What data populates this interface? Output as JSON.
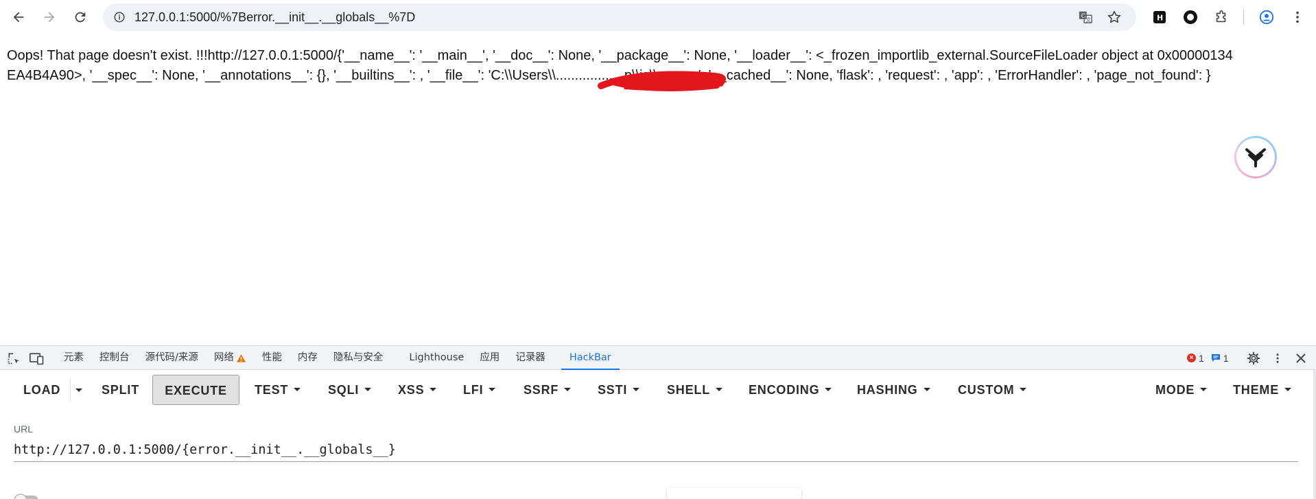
{
  "browser": {
    "address": "127.0.0.1:5000/%7Berror.__init__.__globals__%7D",
    "icons": {
      "back": "arrow-left-icon",
      "forward": "arrow-right-icon",
      "reload": "reload-icon",
      "site_info": "info-circle-icon",
      "translate": "translate-icon",
      "bookmark": "star-icon",
      "extension_h": "h-extension-icon",
      "extension_circle": "circle-extension-icon",
      "extensions": "puzzle-icon",
      "profile": "profile-icon",
      "menu": "kebab-menu-icon"
    }
  },
  "page": {
    "error_text": "Oops! That page doesn't exist. !!!http://127.0.0.1:5000/{'__name__': '__main__', '__doc__': None, '__package__': None, '__loader__': <_frozen_importlib_external.SourceFileLoader object at 0x00000134EA4B4A90>, '__spec__': None, '__annotations__': {}, '__builtins__': , '__file__': 'C:\\\\Users\\\\..................p\\\\js\\\\app.py', '__cached__': None, 'flask': , 'request': , 'app': , 'ErrorHandler': , 'page_not_found': }",
    "floating_widget_icon": "y-logo-icon"
  },
  "devtools": {
    "tabs": [
      {
        "label": "元素"
      },
      {
        "label": "控制台"
      },
      {
        "label": "源代码/来源"
      },
      {
        "label": "网络"
      },
      {
        "label": "性能"
      },
      {
        "label": "内存"
      },
      {
        "label": "隐私与安全"
      },
      {
        "label": "Lighthouse"
      },
      {
        "label": "应用"
      },
      {
        "label": "记录器"
      },
      {
        "label": "HackBar"
      }
    ],
    "active_tab": "HackBar",
    "error_count": "1",
    "message_count": "1",
    "accent_color": "#1a73e8",
    "error_color": "#d93025",
    "warning_color": "#e37400"
  },
  "hackbar": {
    "buttons": {
      "load": "LOAD",
      "split": "SPLIT",
      "execute": "EXECUTE",
      "test": "TEST",
      "sqli": "SQLI",
      "xss": "XSS",
      "lfi": "LFI",
      "ssrf": "SSRF",
      "ssti": "SSTI",
      "shell": "SHELL",
      "encoding": "ENCODING",
      "hashing": "HASHING",
      "custom": "CUSTOM",
      "mode": "MODE",
      "theme": "THEME"
    },
    "url_label": "URL",
    "url_value": "http://127.0.0.1:5000/{error.__init__.__globals__}"
  }
}
